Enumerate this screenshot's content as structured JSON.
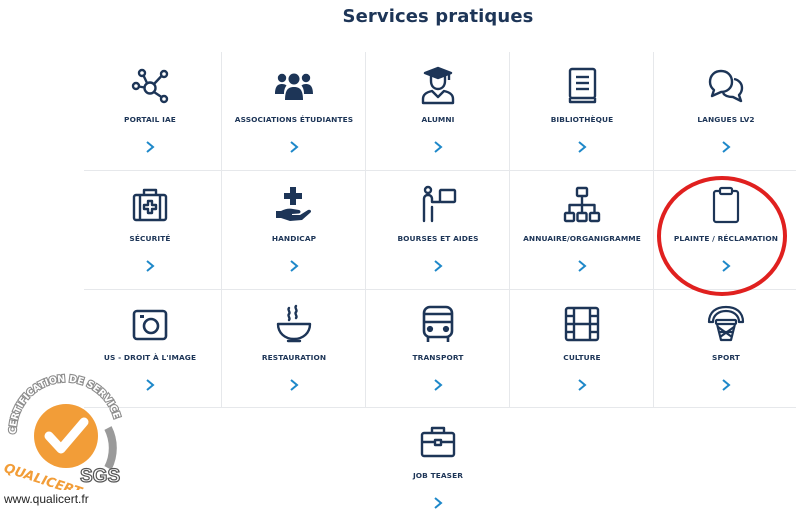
{
  "page": {
    "title": "Services pratiques"
  },
  "colors": {
    "navy": "#1d3557",
    "accent_blue": "#1e88c9",
    "highlight_red": "#e0201f",
    "badge_orange": "#f29d38"
  },
  "tiles": [
    {
      "label": "PORTAIL IAE",
      "icon": "network-nodes-icon"
    },
    {
      "label": "ASSOCIATIONS ÉTUDIANTES",
      "icon": "users-group-icon"
    },
    {
      "label": "ALUMNI",
      "icon": "graduate-icon"
    },
    {
      "label": "BIBLIOTHÈQUE",
      "icon": "book-icon"
    },
    {
      "label": "LANGUES LV2",
      "icon": "speech-bubbles-icon"
    },
    {
      "label": "SÉCURITÉ",
      "icon": "first-aid-kit-icon"
    },
    {
      "label": "HANDICAP",
      "icon": "hand-plus-icon"
    },
    {
      "label": "BOURSES ET AIDES",
      "icon": "person-with-board-icon"
    },
    {
      "label": "ANNUAIRE/ORGANIGRAMME",
      "icon": "org-chart-icon"
    },
    {
      "label": "PLAINTE / RÉCLAMATION",
      "icon": "clipboard-icon"
    },
    {
      "label": "US - DROIT À L'IMAGE",
      "icon": "camera-icon"
    },
    {
      "label": "RESTAURATION",
      "icon": "steaming-bowl-icon"
    },
    {
      "label": "TRANSPORT",
      "icon": "bus-icon"
    },
    {
      "label": "CULTURE",
      "icon": "film-icon"
    },
    {
      "label": "SPORT",
      "icon": "basketball-hoop-icon"
    },
    {
      "label": "JOB TEASER",
      "icon": "briefcase-icon"
    }
  ],
  "badge": {
    "arc_text": "CERTIFICATION DE SERVICES",
    "brand": "QUALICERT",
    "certifier": "SGS",
    "website": "www.qualicert.fr"
  }
}
